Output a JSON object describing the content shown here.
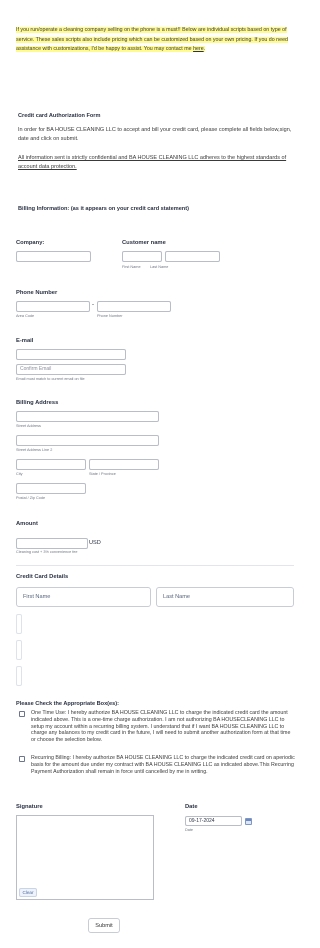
{
  "intro": {
    "text": "If you run/operate a cleaning company selling on the phone is a must!! Below are individual scripts based on type of service. These sales scripts also include pricing which can be customized based on your own pricing. If you do need assistance with customizations, I'd be happy to assist. You may contact me ",
    "link": "here",
    "end": "."
  },
  "auth": {
    "title": "Credit card Authorization Form",
    "body": "In order for BA HOUSE CLEANING LLC to accept and bill your credit card, please complete all fields below,sign, date and click on submit.",
    "note": "All information sent is strictly confidential and BA HOUSE CLEANING LLC adheres to the highest standards of account data protection."
  },
  "billing_info_title": "Billing Information: (as it appears on your credit card statement)",
  "company": {
    "label": "Company:"
  },
  "customer": {
    "label": "Customer name",
    "first_sub": "First Name",
    "last_sub": "Last Name"
  },
  "phone": {
    "label": "Phone Number",
    "dash": "-",
    "area_sub": "Area Code",
    "number_sub": "Phone Number"
  },
  "email": {
    "label": "E-mail",
    "confirm_placeholder": "Confirm Email",
    "note": "Email must match to current email on file"
  },
  "address": {
    "label": "Billing Address",
    "street_sub": "Street Address",
    "street2_sub": "Street Address Line 2",
    "city_sub": "City",
    "state_sub": "State / Province",
    "zip_sub": "Postal / Zip Code"
  },
  "amount": {
    "label": "Amount",
    "currency": "USD",
    "note": "Cleaning cost + 3% convenience fee"
  },
  "card": {
    "label": "Credit Card Details",
    "first_placeholder": "First Name",
    "last_placeholder": "Last Name"
  },
  "checks": {
    "label": "Please Check the Appropriate Box(es):",
    "one_time": "One Time Use: I hereby authorize BA HOUSE CLEANING LLC to charge the indicated credit card the amount indicated above. This is a one-time charge authorization. I am not authorizing BA HOUSECLEANING LLC to setup my account within a recurring billing system. I understand that if I want BA HOUSE CLEANING LLC to charge any balances to my credit card in the future, I will need to submit another authorization form at that time or choose the selection below.",
    "recurring": "Recurring Billing: I hereby authorize BA HOUSE CLEANING LLC to charge the indicated credit card on aperiodic basis for the amount due under my contract with BA HOUSE CLEANING LLC as indicated above.This Recurring Payment Authorization shall remain in force until cancelled by me in writing."
  },
  "signature": {
    "label": "Signature",
    "clear": "Clear"
  },
  "date": {
    "label": "Date",
    "value": "09-17-2024",
    "sub": "Date"
  },
  "submit": "Submit"
}
